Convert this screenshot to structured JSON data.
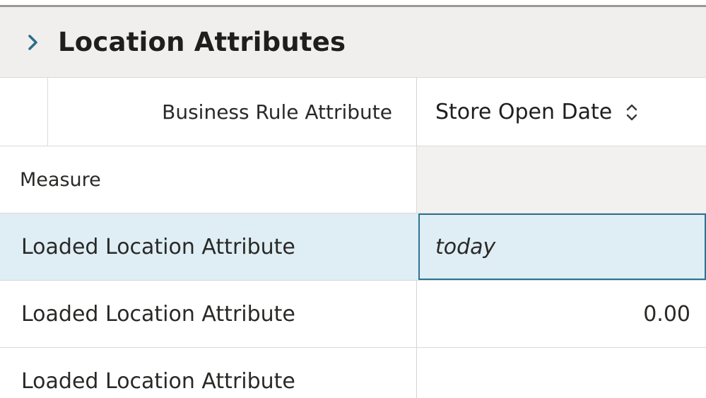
{
  "panel": {
    "title": "Location Attributes",
    "disclosure_icon": "chevron-right-icon",
    "expanded": false
  },
  "grid": {
    "corner_label": "Business Rule Attribute",
    "measure_label": "Measure",
    "columns": [
      {
        "label": "Store Open Date",
        "sort_icon": "sort-up-down-icon"
      }
    ],
    "rows": [
      {
        "label": "Loaded Location Attribute",
        "value": "today",
        "selected": true
      },
      {
        "label": "Loaded Location Attribute",
        "value": "0.00",
        "selected": false
      },
      {
        "label": "Loaded Location Attribute",
        "value": "",
        "selected": false
      }
    ]
  },
  "colors": {
    "header_bg": "#f1efed",
    "selected_row_bg": "#dfeef5",
    "focus_border": "#2b7391",
    "chevron": "#2b6f8c"
  }
}
